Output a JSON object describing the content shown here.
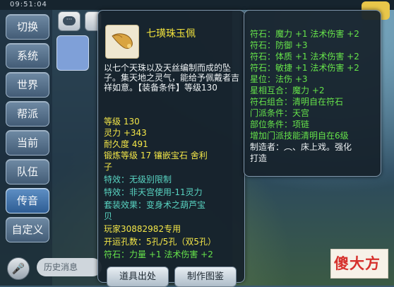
{
  "status_bar": {
    "time": "09:51:04"
  },
  "channels": [
    {
      "label": "切换",
      "active": false
    },
    {
      "label": "系统",
      "active": false
    },
    {
      "label": "世界",
      "active": false
    },
    {
      "label": "帮派",
      "active": false
    },
    {
      "label": "当前",
      "active": false
    },
    {
      "label": "队伍",
      "active": false
    },
    {
      "label": "传音",
      "active": true
    },
    {
      "label": "自定义",
      "active": false
    }
  ],
  "chat_input": {
    "placeholder": "历史消息"
  },
  "item": {
    "name": "七璜珠玉佩",
    "description": "以七个天珠以及天丝编制而成的坠子。集天地之灵气，能给予佩戴者吉祥如意。",
    "equip_condition_label": "【装备条件】",
    "equip_condition_value": "等级130",
    "level": "等级 130",
    "spirit": "灵力 +343",
    "durability": "耐久度 491",
    "forge_line": "锻炼等级 17  镶嵌宝石 舍利",
    "forge_line_2": "子",
    "effect": "特效：无级别限制",
    "effect_2": "特效：非天宫使用-11灵力",
    "set_effect": "套装效果：变身术之葫芦宝",
    "set_effect_2": "贝",
    "owner": "玩家30882982专用",
    "slots": "开运孔数：5孔/5孔（双5孔）",
    "rune_bottom": "符石：力量 +1 法术伤害 +2"
  },
  "buttons": {
    "source": "道具出处",
    "craft": "制作图鉴"
  },
  "attributes": [
    {
      "text": "符石：魔力 +1 法术伤害 +2",
      "color": "#66e34a"
    },
    {
      "text": "符石：防御 +3",
      "color": "#66e34a"
    },
    {
      "text": "符石：体质 +1 法术伤害 +2",
      "color": "#66e34a"
    },
    {
      "text": "符石：敏捷 +1 法术伤害 +2",
      "color": "#66e34a"
    },
    {
      "text": "星位：法伤 +3",
      "color": "#66e34a"
    },
    {
      "text": "星相互合：魔力 +2",
      "color": "#66e34a"
    },
    {
      "text": "符石组合：清明自在符石",
      "color": "#66e34a"
    },
    {
      "text": "门派条件：天宫",
      "color": "#66e34a"
    },
    {
      "text": "部位条件：项链",
      "color": "#66e34a"
    },
    {
      "text": "增加门派技能清明自在6级",
      "color": "#66e34a"
    },
    {
      "text": "制造者：︵、床上戏。强化",
      "color": "#eef2f4"
    },
    {
      "text": "打造",
      "color": "#eef2f4"
    }
  ],
  "watermark": {
    "text": "傻大方"
  }
}
